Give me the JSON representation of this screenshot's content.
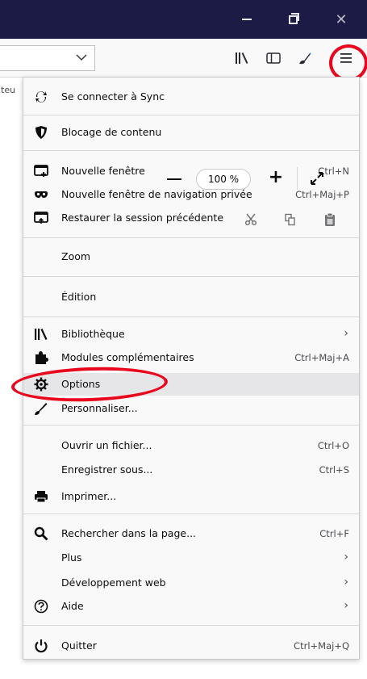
{
  "titlebar": {
    "minimize": "Réduire",
    "restore": "Restaurer",
    "close_glyph": "✕"
  },
  "toolbar": {
    "page_strip_text": "teu",
    "icons": [
      "library-icon",
      "sidebar-icon",
      "customize-icon",
      "hamburger-menu-icon"
    ]
  },
  "menu": {
    "sync": {
      "label": "Se connecter à Sync"
    },
    "blocking": {
      "label": "Blocage de contenu"
    },
    "new_window": {
      "label": "Nouvelle fenêtre",
      "shortcut": "Ctrl+N"
    },
    "private_window": {
      "label": "Nouvelle fenêtre de navigation privée",
      "shortcut": "Ctrl+Maj+P"
    },
    "restore_session": {
      "label": "Restaurer la session précédente"
    },
    "zoom": {
      "label": "Zoom",
      "value": "100 %",
      "minus": "−",
      "plus": "+"
    },
    "edit": {
      "label": "Édition"
    },
    "library": {
      "label": "Bibliothèque",
      "arrow": "›"
    },
    "addons": {
      "label": "Modules complémentaires",
      "shortcut": "Ctrl+Maj+A"
    },
    "options": {
      "label": "Options"
    },
    "customize": {
      "label": "Personnaliser..."
    },
    "open_file": {
      "label": "Ouvrir un fichier...",
      "shortcut": "Ctrl+O"
    },
    "save_as": {
      "label": "Enregistrer sous...",
      "shortcut": "Ctrl+S"
    },
    "print": {
      "label": "Imprimer..."
    },
    "find": {
      "label": "Rechercher dans la page...",
      "shortcut": "Ctrl+F"
    },
    "more": {
      "label": "Plus",
      "arrow": "›"
    },
    "webdev": {
      "label": "Développement web",
      "arrow": "›"
    },
    "help": {
      "label": "Aide",
      "arrow": "›"
    },
    "quit": {
      "label": "Quitter",
      "shortcut": "Ctrl+Maj+Q"
    }
  },
  "colors": {
    "titlebar": "#1c1b45",
    "annotation_red": "#e8071c",
    "panel_bg": "#f9f9fa",
    "highlight": "#e6e6e9"
  }
}
